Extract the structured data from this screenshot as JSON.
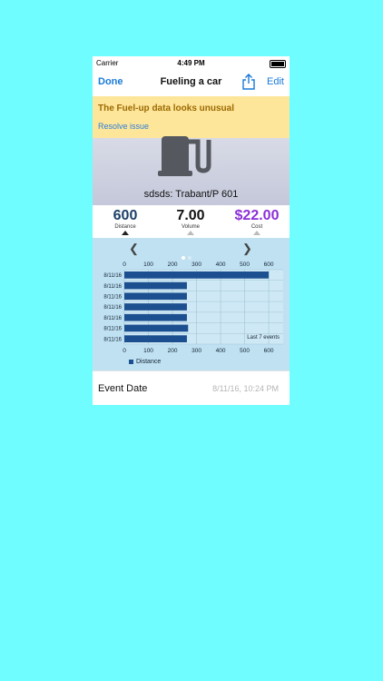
{
  "status": {
    "carrier": "Carrier",
    "time": "4:49 PM"
  },
  "nav": {
    "done_label": "Done",
    "title": "Fueling a car",
    "edit_label": "Edit",
    "share_icon": "share-icon"
  },
  "warning": {
    "message": "The Fuel-up data looks unusual",
    "action": "Resolve issue"
  },
  "vehicle": {
    "name": "sdsds: Trabant/P 601",
    "icon": "fuel-pump-icon"
  },
  "stats": [
    {
      "value": "600",
      "label": "Distance",
      "color": "#1c3f66"
    },
    {
      "value": "7.00",
      "label": "Volume",
      "color": "#111111"
    },
    {
      "value": "$22.00",
      "label": "Cost",
      "color": "#8b2fd6"
    }
  ],
  "chart_data": {
    "type": "bar",
    "orientation": "horizontal",
    "categories": [
      "8/11/16",
      "8/11/16",
      "8/11/16",
      "8/11/16",
      "8/11/16",
      "8/11/16",
      "8/11/16"
    ],
    "series": [
      {
        "name": "Distance",
        "values": [
          600,
          260,
          260,
          260,
          260,
          265,
          260
        ],
        "color": "#1c4f8f"
      }
    ],
    "xlim": [
      0,
      660
    ],
    "ticks": [
      0,
      100,
      200,
      300,
      400,
      500,
      600
    ],
    "annotation": "Last 7 events",
    "grid": true,
    "legend_position": "bottom-left"
  },
  "event": {
    "label": "Event Date",
    "value": "8/11/16, 10:24 PM"
  }
}
